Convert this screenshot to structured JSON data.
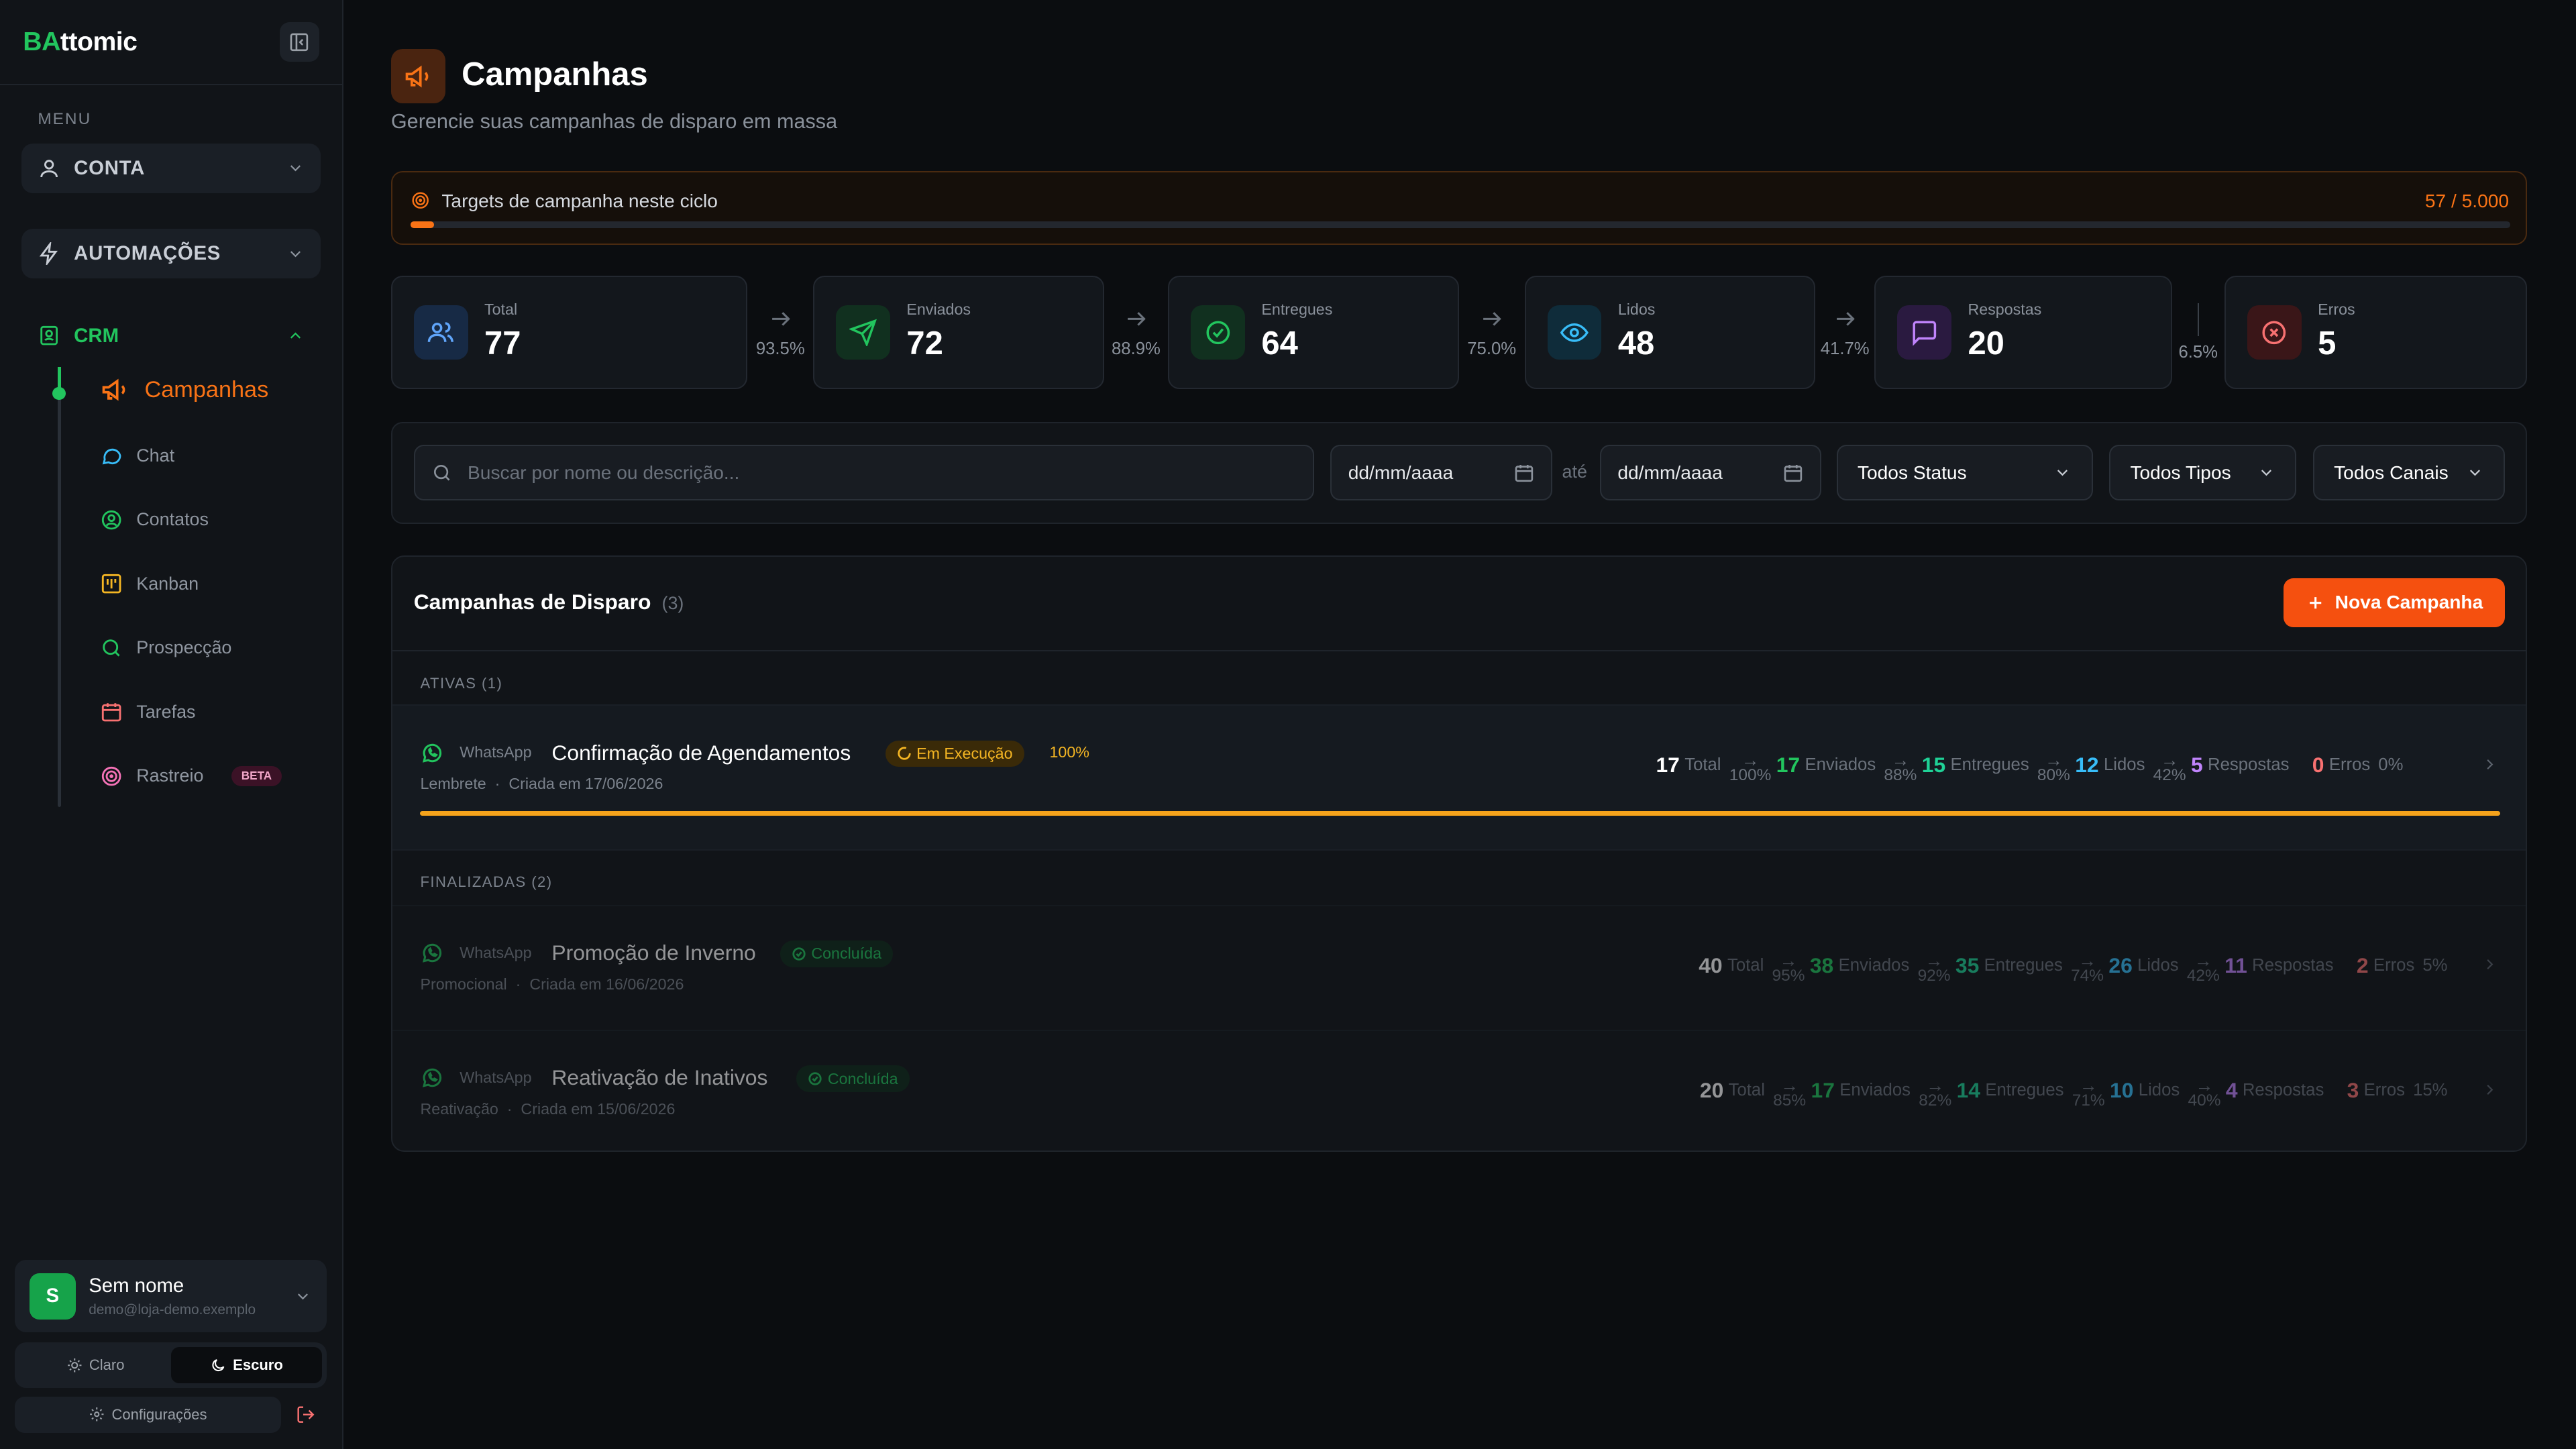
{
  "sidebar": {
    "brand_a": "BA",
    "brand_b": "ttomic",
    "menu_label": "MENU",
    "groups": [
      {
        "label": "CONTA"
      },
      {
        "label": "AUTOMAÇÕES"
      }
    ],
    "crm": {
      "label": "CRM"
    },
    "items": [
      {
        "label": "Campanhas",
        "icon": "megaphone-icon"
      },
      {
        "label": "Chat",
        "icon": "chat-icon"
      },
      {
        "label": "Contatos",
        "icon": "contact-icon"
      },
      {
        "label": "Kanban",
        "icon": "kanban-icon"
      },
      {
        "label": "Prospecção",
        "icon": "search-icon"
      },
      {
        "label": "Tarefas",
        "icon": "calendar-icon"
      },
      {
        "label": "Rastreio",
        "icon": "target-icon",
        "badge": "BETA"
      }
    ],
    "user": {
      "initial": "S",
      "name": "Sem nome",
      "email": "demo@loja-demo.exemplo"
    },
    "theme": {
      "light": "Claro",
      "dark": "Escuro",
      "selected": "Escuro"
    },
    "settings": "Configurações"
  },
  "header": {
    "title": "Campanhas",
    "subtitle": "Gerencie suas campanhas de disparo em massa"
  },
  "quota": {
    "label": "Targets de campanha neste ciclo",
    "value": "57 / 5.000",
    "used": 57,
    "limit": 5000
  },
  "stats": [
    {
      "label": "Total",
      "value": "77",
      "color": "#60a5fa"
    },
    {
      "label": "Enviados",
      "value": "72",
      "color": "#22c55e"
    },
    {
      "label": "Entregues",
      "value": "64",
      "color": "#22c55e"
    },
    {
      "label": "Lidos",
      "value": "48",
      "color": "#38bdf8"
    },
    {
      "label": "Respostas",
      "value": "20",
      "color": "#c084fc"
    },
    {
      "label": "Erros",
      "value": "5",
      "color": "#f87171"
    }
  ],
  "conversions": [
    "93.5%",
    "88.9%",
    "75.0%",
    "41.7%",
    "6.5%"
  ],
  "filters": {
    "search_placeholder": "Buscar por nome ou descrição...",
    "date_from": "dd/mm/aaaa",
    "date_sep": "até",
    "date_to": "dd/mm/aaaa",
    "status": "Todos Status",
    "type": "Todos Tipos",
    "channel": "Todos Canais"
  },
  "panel": {
    "title": "Campanhas de Disparo",
    "count": "(3)",
    "new_button": "Nova Campanha",
    "active_label": "ATIVAS (1)",
    "finished_label": "FINALIZADAS (2)"
  },
  "campaigns": [
    {
      "channel": "WhatsApp",
      "name": "Confirmação de Agendamentos",
      "status": "Em Execução",
      "progress_text": "100%",
      "progress": 1.0,
      "type": "Lembrete",
      "created": "Criada em 17/06/2026",
      "total": "17",
      "sent": "17",
      "delivered": "15",
      "read": "12",
      "replies": "5",
      "errors": "0",
      "p_sent": "100%",
      "p_delivered": "88%",
      "p_read": "80%",
      "p_replies": "42%",
      "p_errors": "0%"
    },
    {
      "channel": "WhatsApp",
      "name": "Promoção de Inverno",
      "status": "Concluída",
      "type": "Promocional",
      "created": "Criada em 16/06/2026",
      "total": "40",
      "sent": "38",
      "delivered": "35",
      "read": "26",
      "replies": "11",
      "errors": "2",
      "p_sent": "95%",
      "p_delivered": "92%",
      "p_read": "74%",
      "p_replies": "42%",
      "p_errors": "5%"
    },
    {
      "channel": "WhatsApp",
      "name": "Reativação de Inativos",
      "status": "Concluída",
      "type": "Reativação",
      "created": "Criada em 15/06/2026",
      "total": "20",
      "sent": "17",
      "delivered": "14",
      "read": "10",
      "replies": "4",
      "errors": "3",
      "p_sent": "85%",
      "p_delivered": "82%",
      "p_read": "71%",
      "p_replies": "40%",
      "p_errors": "15%"
    }
  ],
  "metric_labels": {
    "total": "Total",
    "sent": "Enviados",
    "delivered": "Entregues",
    "read": "Lidos",
    "replies": "Respostas",
    "errors": "Erros"
  },
  "colors": {
    "accent": "#f97316",
    "brand": "#22c55e",
    "primary_button": "#f5500f"
  }
}
